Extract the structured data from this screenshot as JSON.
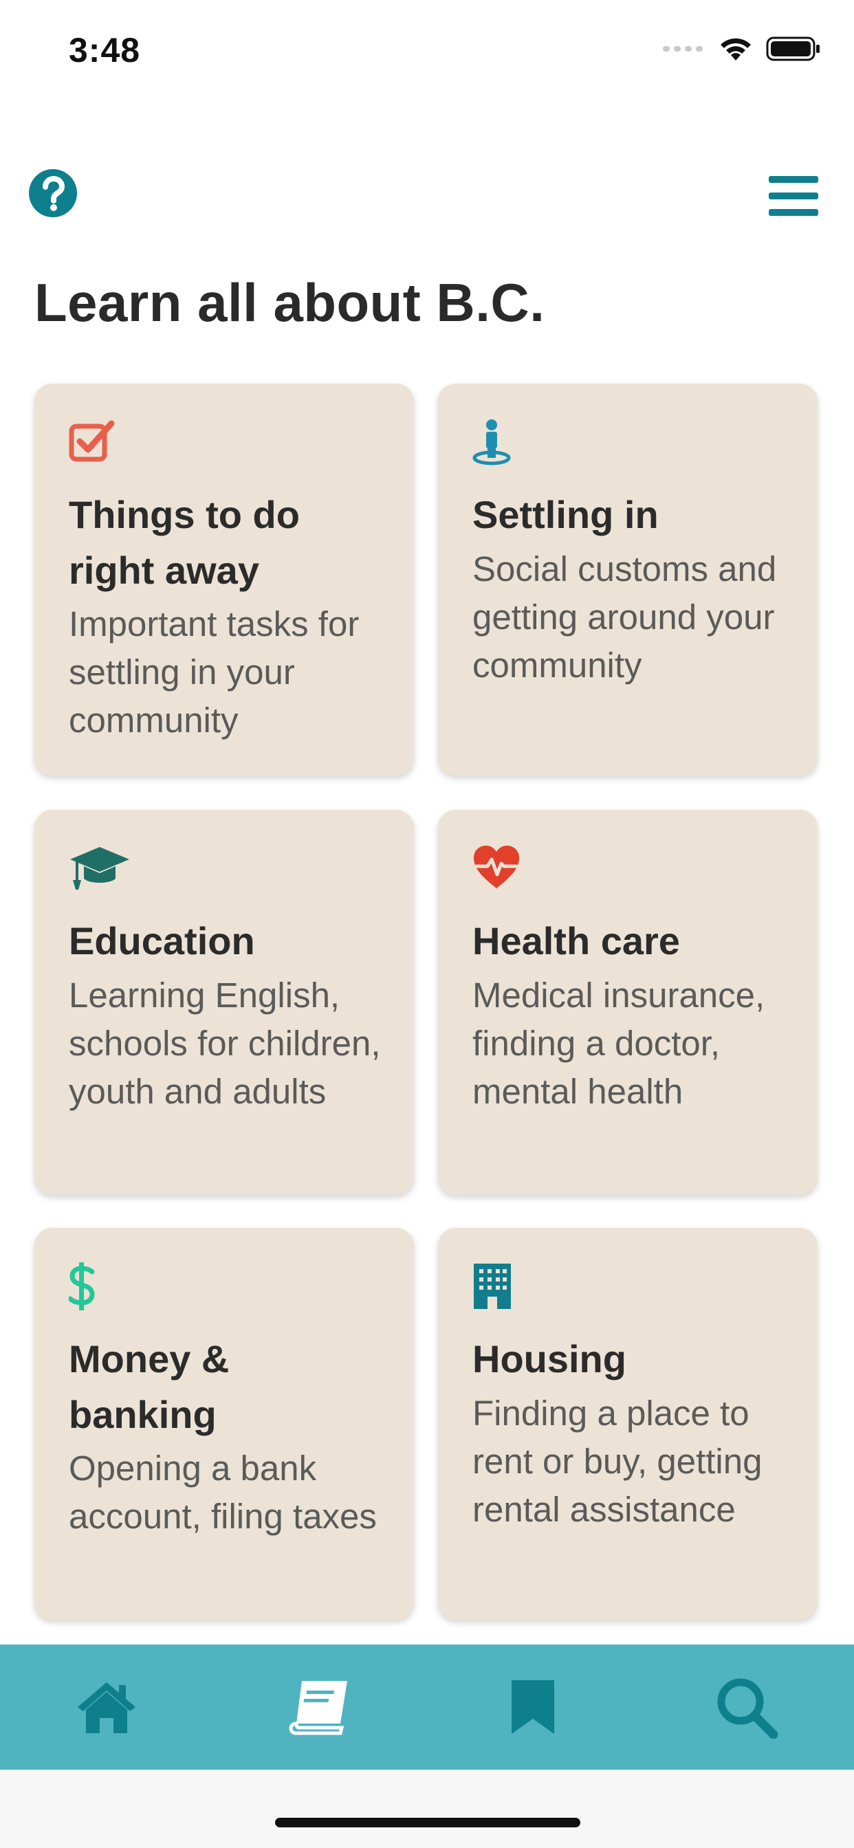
{
  "status_bar": {
    "time": "3:48"
  },
  "page": {
    "title": "Learn all about B.C."
  },
  "cards": [
    {
      "title": "Things to do right away",
      "description": "Important tasks for settling in your community",
      "icon": "checkbox-icon",
      "icon_color": "#e8604c"
    },
    {
      "title": "Settling in",
      "description": "Social customs and getting around your community",
      "icon": "person-pin-icon",
      "icon_color": "#1e8fb0"
    },
    {
      "title": "Education",
      "description": "Learning English, schools for children, youth and adults",
      "icon": "graduation-cap-icon",
      "icon_color": "#1f6f66"
    },
    {
      "title": "Health care",
      "description": "Medical insurance, finding a doctor, mental health",
      "icon": "heart-pulse-icon",
      "icon_color": "#e2402b"
    },
    {
      "title": "Money & banking",
      "description": "Opening a bank account, filing taxes",
      "icon": "dollar-icon",
      "icon_color": "#22c79a"
    },
    {
      "title": "Housing",
      "description": "Finding a place to rent or buy, getting rental assistance",
      "icon": "building-icon",
      "icon_color": "#127d8c"
    }
  ],
  "tab_bar": {
    "items": [
      {
        "icon": "home-icon"
      },
      {
        "icon": "book-icon",
        "active": true
      },
      {
        "icon": "bookmark-icon"
      },
      {
        "icon": "search-icon"
      }
    ]
  },
  "colors": {
    "accent": "#0e7f8c",
    "card_bg": "#ece3d6",
    "tab_bar_bg": "#4fb3c0"
  }
}
